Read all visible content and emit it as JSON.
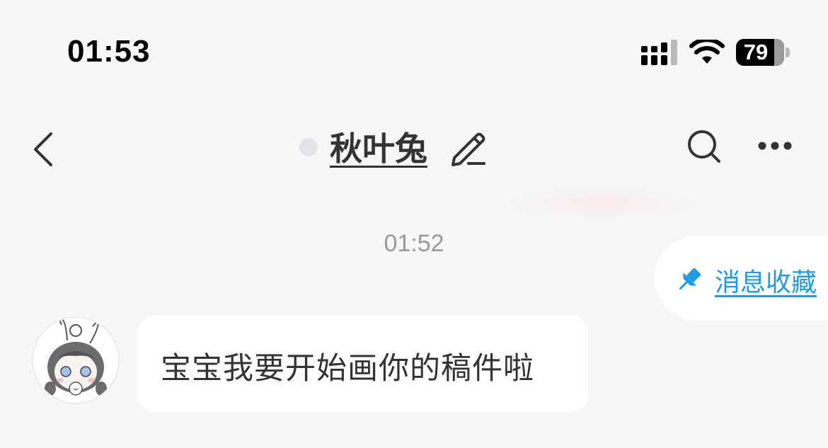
{
  "status_bar": {
    "time": "01:53",
    "battery": "79",
    "signal_icon": "cellular-signal-icon",
    "wifi_icon": "wifi-icon"
  },
  "header": {
    "contact_name": "秋叶兔",
    "back_icon": "chevron-left-icon",
    "edit_icon": "pencil-icon",
    "search_icon": "search-icon",
    "more_icon": "ellipsis-icon"
  },
  "chat": {
    "timestamp": "01:52",
    "favorites_label": "消息收藏",
    "message_text": "宝宝我要开始画你的稿件啦"
  },
  "colors": {
    "background": "#f6f7f9",
    "accent": "#1e9be8",
    "text": "#333333"
  }
}
